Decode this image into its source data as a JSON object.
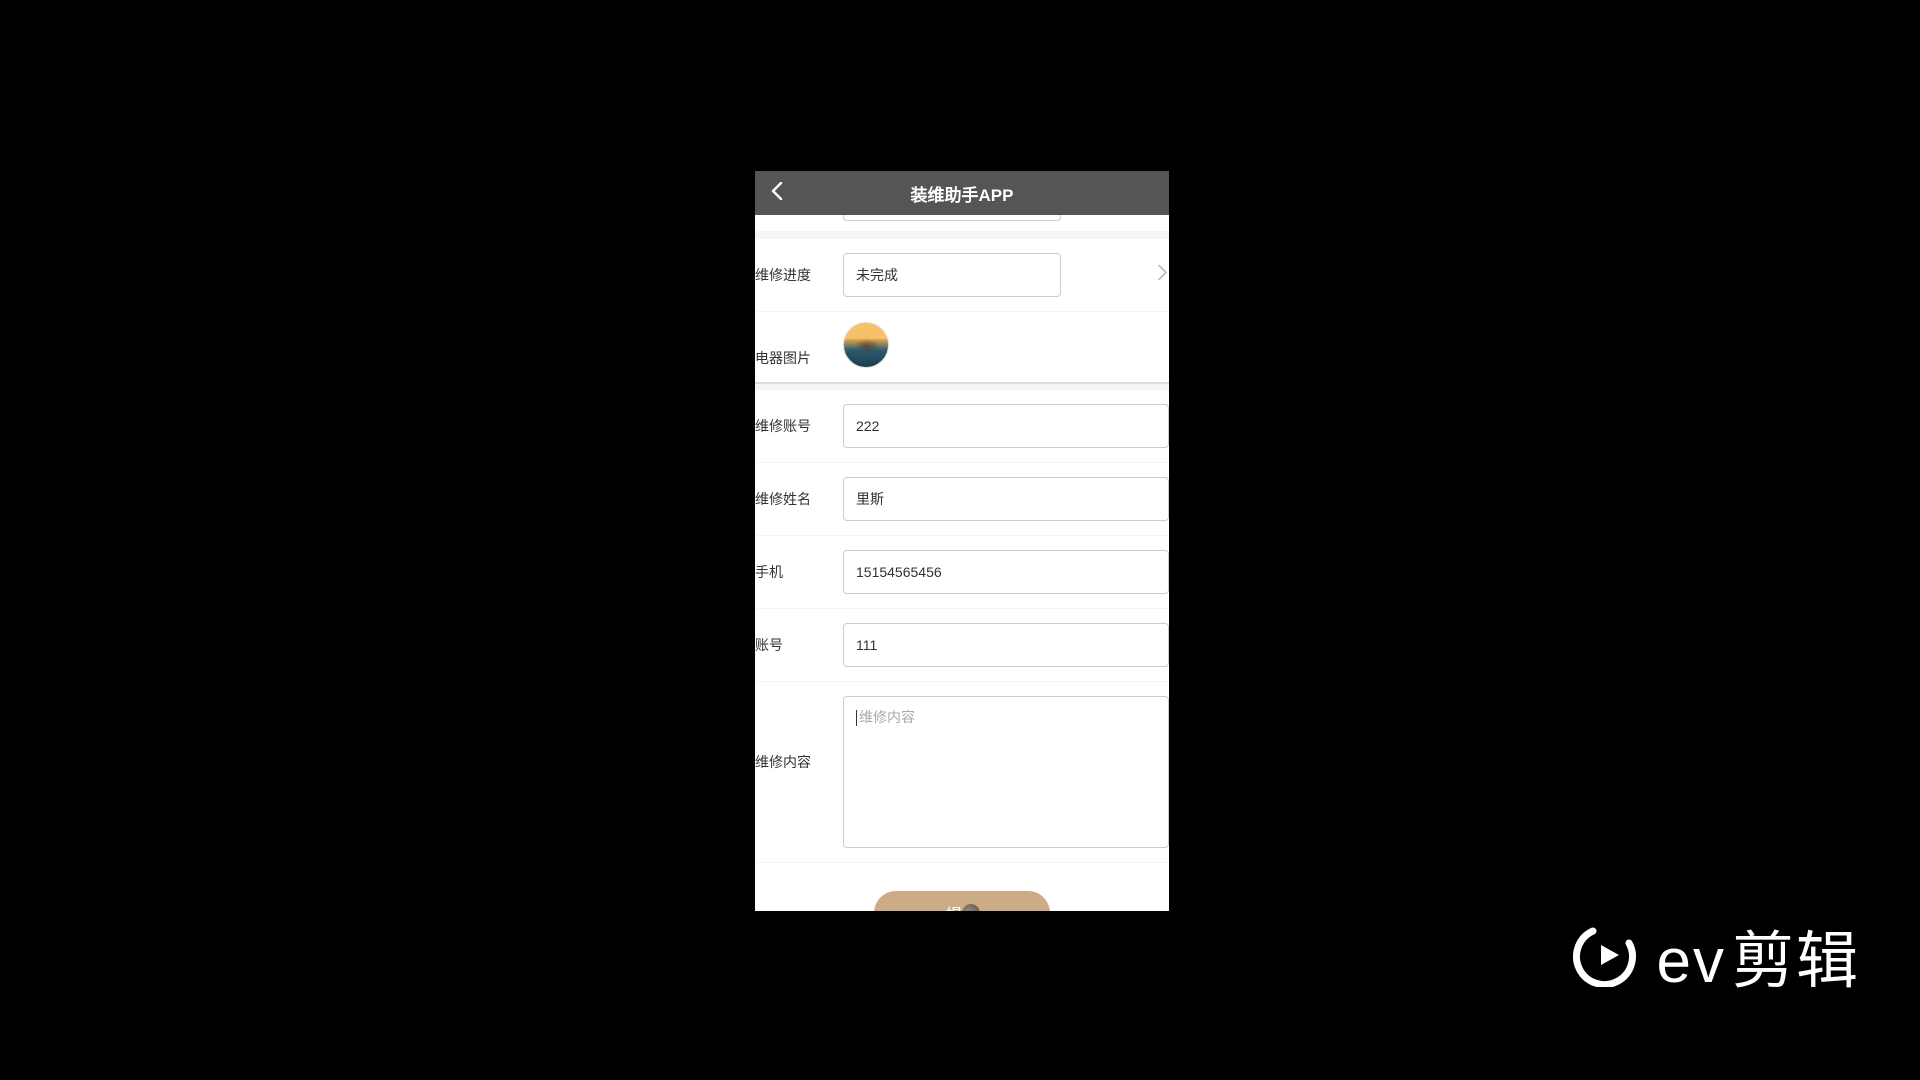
{
  "header": {
    "title": "装维助手APP"
  },
  "form": {
    "progress": {
      "label": "维修进度",
      "value": "未完成"
    },
    "image": {
      "label": "电器图片"
    },
    "repair_account": {
      "label": "维修账号",
      "value": "222"
    },
    "repair_name": {
      "label": "维修姓名",
      "value": "里斯"
    },
    "phone": {
      "label": "手机",
      "value": "15154565456"
    },
    "account": {
      "label": "账号",
      "value": "111"
    },
    "content": {
      "label": "维修内容",
      "placeholder": "维修内容"
    },
    "submit_label": "提交"
  },
  "watermark": {
    "brand_en": "ev",
    "brand_cn": "剪辑"
  }
}
